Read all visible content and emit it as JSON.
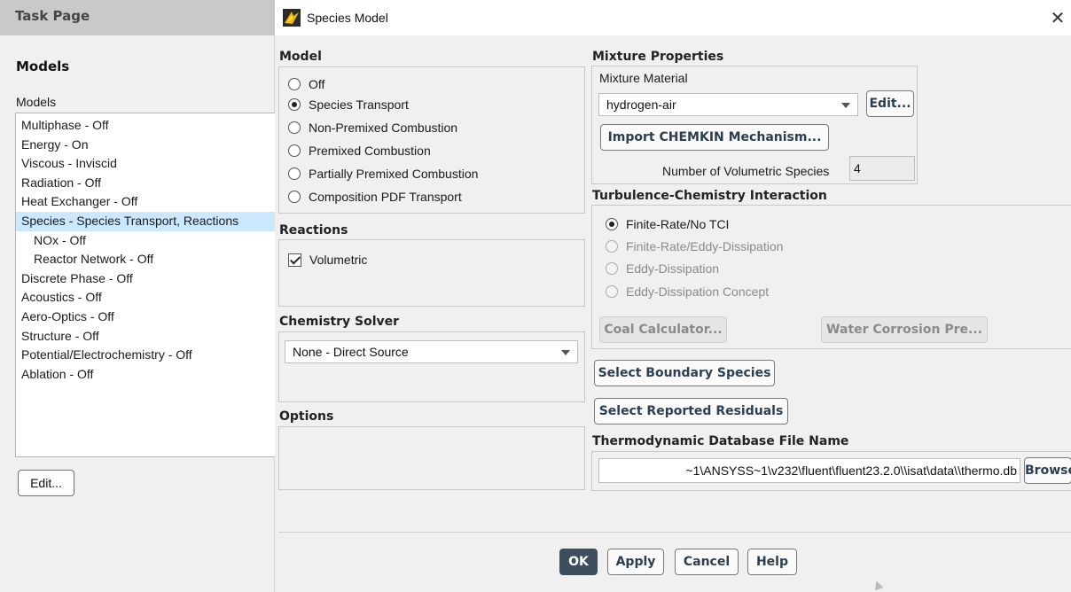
{
  "task_page": {
    "header": "Task Page",
    "heading": "Models",
    "list_label": "Models",
    "models": [
      {
        "label": "Multiphase - Off",
        "sub": false,
        "selected": false
      },
      {
        "label": "Energy - On",
        "sub": false,
        "selected": false
      },
      {
        "label": "Viscous - Inviscid",
        "sub": false,
        "selected": false
      },
      {
        "label": "Radiation - Off",
        "sub": false,
        "selected": false
      },
      {
        "label": "Heat Exchanger - Off",
        "sub": false,
        "selected": false
      },
      {
        "label": "Species - Species Transport, Reactions",
        "sub": false,
        "selected": true
      },
      {
        "label": "NOx - Off",
        "sub": true,
        "selected": false
      },
      {
        "label": "Reactor Network - Off",
        "sub": true,
        "selected": false
      },
      {
        "label": "Discrete Phase - Off",
        "sub": false,
        "selected": false
      },
      {
        "label": "Acoustics - Off",
        "sub": false,
        "selected": false
      },
      {
        "label": "Aero-Optics - Off",
        "sub": false,
        "selected": false
      },
      {
        "label": "Structure - Off",
        "sub": false,
        "selected": false
      },
      {
        "label": "Potential/Electrochemistry - Off",
        "sub": false,
        "selected": false
      },
      {
        "label": "Ablation - Off",
        "sub": false,
        "selected": false
      }
    ],
    "edit_button": "Edit..."
  },
  "dialog": {
    "title": "Species Model",
    "close_glyph": "✕",
    "model": {
      "title": "Model",
      "options": [
        "Off",
        "Species Transport",
        "Non-Premixed Combustion",
        "Premixed Combustion",
        "Partially Premixed Combustion",
        "Composition PDF Transport"
      ],
      "selected_index": 1
    },
    "reactions": {
      "title": "Reactions",
      "volumetric_label": "Volumetric",
      "volumetric_checked": true
    },
    "chemistry_solver": {
      "title": "Chemistry Solver",
      "value": "None - Direct Source"
    },
    "options": {
      "title": "Options"
    },
    "mixture_properties": {
      "title": "Mixture Properties",
      "material_label": "Mixture Material",
      "material_value": "hydrogen-air",
      "edit_button": "Edit...",
      "import_button": "Import CHEMKIN Mechanism...",
      "num_species_label": "Number of Volumetric Species",
      "num_species_value": "4"
    },
    "tci": {
      "title": "Turbulence-Chemistry Interaction",
      "options": [
        {
          "label": "Finite-Rate/No TCI",
          "checked": true,
          "enabled": true
        },
        {
          "label": "Finite-Rate/Eddy-Dissipation",
          "checked": false,
          "enabled": false
        },
        {
          "label": "Eddy-Dissipation",
          "checked": false,
          "enabled": false
        },
        {
          "label": "Eddy-Dissipation Concept",
          "checked": false,
          "enabled": false
        }
      ],
      "coal_button": "Coal Calculator...",
      "water_button": "Water Corrosion Pre..."
    },
    "select_boundary_button": "Select Boundary Species",
    "select_residuals_button": "Select Reported Residuals",
    "thermo": {
      "title": "Thermodynamic Database File Name",
      "path": "~1\\ANSYSS~1\\v232\\fluent\\fluent23.2.0\\\\isat\\data\\\\thermo.db",
      "browse_button": "Browse..."
    },
    "footer": {
      "ok": "OK",
      "apply": "Apply",
      "cancel": "Cancel",
      "help": "Help"
    }
  }
}
